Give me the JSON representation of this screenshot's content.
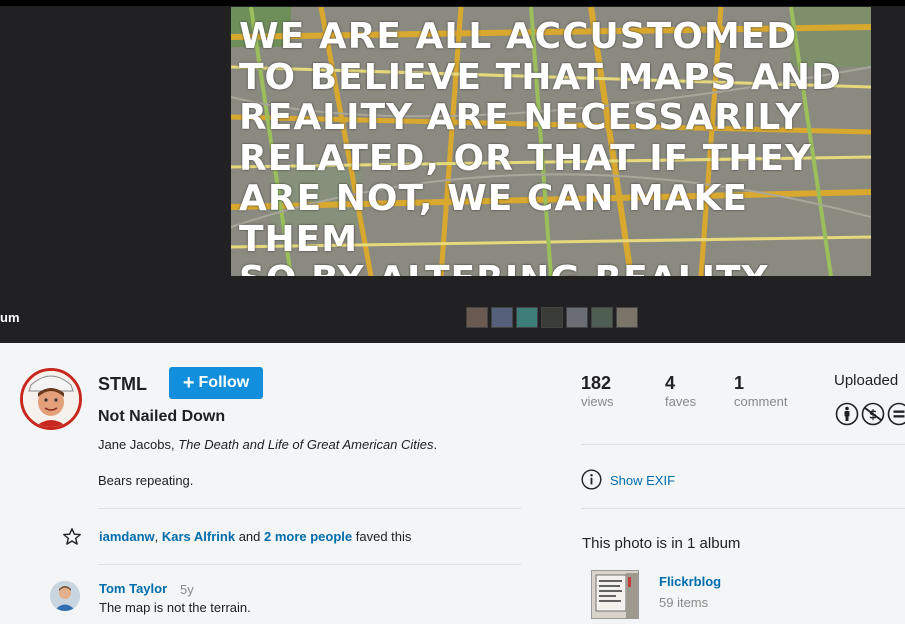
{
  "photo": {
    "quote_text": "WE ARE ALL ACCUSTOMED\nTO BELIEVE THAT MAPS AND\nREALITY ARE NECESSARILY\nRELATED, OR THAT IF THEY\nARE NOT, WE CAN MAKE THEM\nSO BY ALTERING REALITY.",
    "partial_album_label": "um",
    "filmstrip_count": 7
  },
  "owner": {
    "name": "STML",
    "follow_label": "Follow"
  },
  "photo_info": {
    "title": "Not Nailed Down",
    "description_author": "Jane Jacobs, ",
    "description_book": "The Death and Life of Great American Cities",
    "description_end": ".",
    "note": "Bears repeating."
  },
  "faves": {
    "user1": "iamdanw",
    "separator": ", ",
    "user2": "Kars Alfrink",
    "and": " and ",
    "more": "2 more people",
    "suffix": " faved this"
  },
  "comment": {
    "author": "Tom Taylor",
    "age": "5y",
    "text": "The map is not the terrain."
  },
  "stats": {
    "views_num": "182",
    "views_label": "views",
    "faves_num": "4",
    "faves_label": "faves",
    "comments_num": "1",
    "comments_label": "comment"
  },
  "uploaded_label": "Uploaded",
  "exif_label": "Show EXIF",
  "albums": {
    "heading": "This photo is in 1 album",
    "name": "Flickrblog",
    "count": "59 items"
  },
  "colors": {
    "link": "#006dac",
    "follow_bg": "#128fdc",
    "avatar_ring": "#c8271e"
  }
}
